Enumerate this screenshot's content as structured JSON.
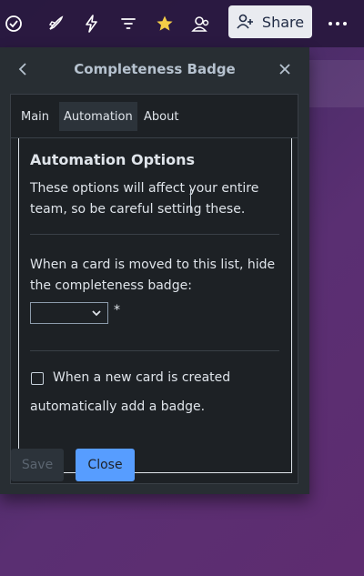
{
  "topbar": {
    "icons": [
      "check-circle-icon",
      "rocket-icon",
      "bolt-icon",
      "filter-icon",
      "star-icon",
      "people-icon",
      "more-icon"
    ],
    "share_label": "Share",
    "star_color": "#f5cd47"
  },
  "popover": {
    "title": "Completeness Badge",
    "tabs": [
      {
        "label": "Main"
      },
      {
        "label": "Automation",
        "active": true
      },
      {
        "label": "About"
      }
    ],
    "heading": "Automation Options",
    "warning_text": "These options will affect your entire team, so be careful setting these.",
    "hide_text": "When a card is moved to this list, hide the completeness badge:",
    "select_value": "",
    "required_mark": "*",
    "auto_text_1": "When a new card is created",
    "auto_text_2": "automatically add a badge.",
    "checkbox_checked": false,
    "save_label": "Save",
    "close_label": "Close"
  },
  "colors": {
    "accent": "#579dff",
    "popover_bg": "#282e33",
    "panel_bg": "#1d2125"
  }
}
